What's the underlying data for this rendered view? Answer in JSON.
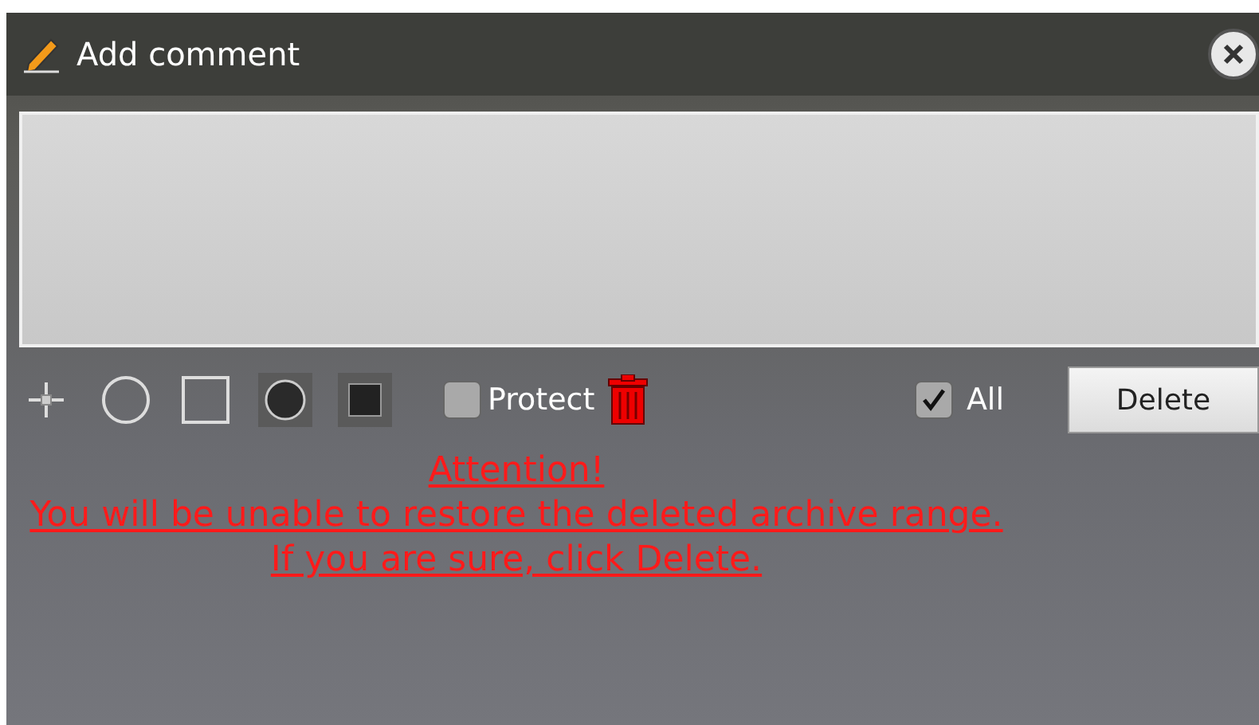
{
  "dialog": {
    "title": "Add comment"
  },
  "toolbar": {
    "tools": [
      {
        "kind": "crosshair",
        "selected": false
      },
      {
        "kind": "circle",
        "selected": false
      },
      {
        "kind": "square",
        "selected": false
      },
      {
        "kind": "filled-circle",
        "selected": true
      },
      {
        "kind": "filled-square",
        "selected": true
      }
    ],
    "protect": {
      "label": "Protect",
      "checked": false
    },
    "all": {
      "label": "All",
      "checked": true
    },
    "delete_button": "Delete"
  },
  "warning": [
    "Attention!",
    "You will be unable to restore the deleted archive range.",
    "If you are sure, click Delete."
  ]
}
